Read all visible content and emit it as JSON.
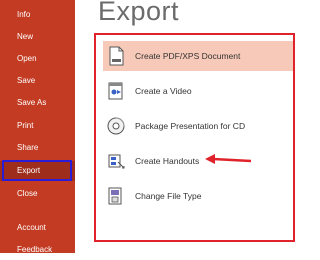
{
  "sidebar": {
    "items": [
      {
        "id": "info",
        "label": "Info",
        "icon": "info"
      },
      {
        "id": "new",
        "label": "New",
        "icon": "new"
      },
      {
        "id": "open",
        "label": "Open",
        "icon": "open"
      },
      {
        "id": "save",
        "label": "Save",
        "icon": "save"
      },
      {
        "id": "save-as",
        "label": "Save As",
        "icon": "save-as"
      },
      {
        "id": "print",
        "label": "Print",
        "icon": "print"
      },
      {
        "id": "share",
        "label": "Share",
        "icon": "share"
      },
      {
        "id": "export",
        "label": "Export",
        "icon": "export",
        "selected": true
      },
      {
        "id": "close",
        "label": "Close",
        "icon": "close"
      },
      {
        "id": "account",
        "label": "Account",
        "icon": "account"
      },
      {
        "id": "feedback",
        "label": "Feedback",
        "icon": "feedback"
      }
    ]
  },
  "main": {
    "title": "Export",
    "options": [
      {
        "label": "Create PDF/XPS Document",
        "icon": "pdf-document-icon",
        "selected": true
      },
      {
        "label": "Create a Video",
        "icon": "video-icon"
      },
      {
        "label": "Package Presentation for CD",
        "icon": "cd-icon"
      },
      {
        "label": "Create Handouts",
        "icon": "handouts-icon"
      },
      {
        "label": "Change File Type",
        "icon": "change-file-type-icon"
      }
    ]
  },
  "colors": {
    "sidebar_bg": "#c23b22",
    "sidebar_selected": "#9e2d1c",
    "annotation_red": "#e0232b",
    "annotation_blue": "#2a1bd6",
    "option_selected_bg": "#f7c9b8"
  }
}
